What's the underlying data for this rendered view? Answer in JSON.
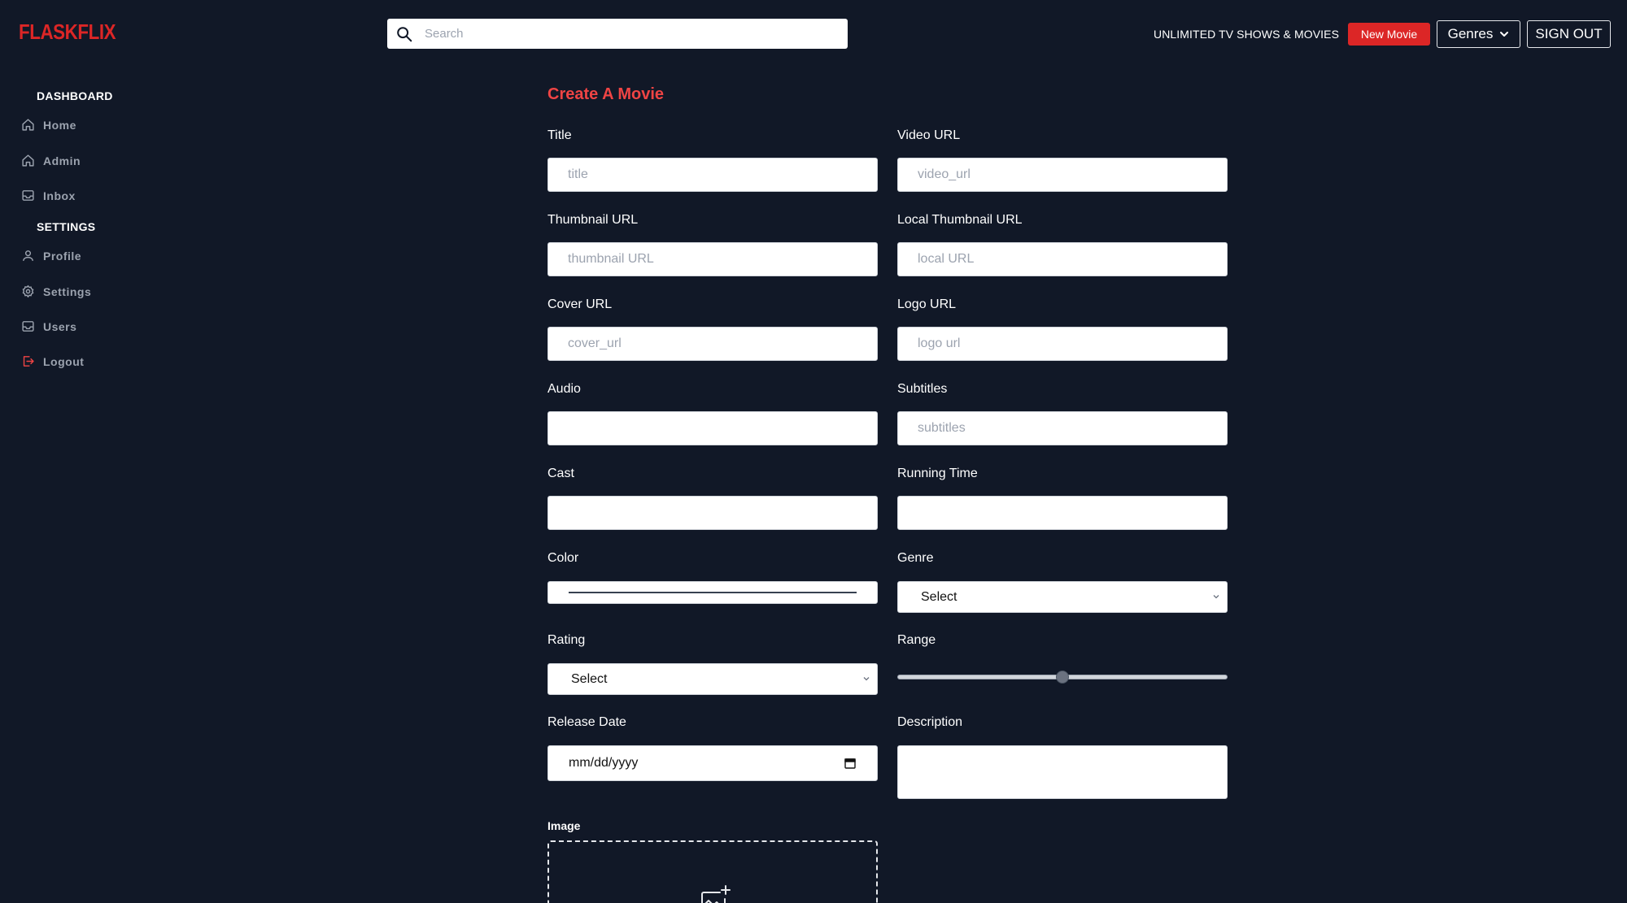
{
  "header": {
    "logo": "FLASKFLIX",
    "search_placeholder": "Search",
    "tagline": "UNLIMITED TV SHOWS & MOVIES",
    "new_movie_label": "New Movie",
    "genres_label": "Genres",
    "signout_label": "SIGN OUT"
  },
  "sidebar": {
    "sections": [
      {
        "heading": "DASHBOARD",
        "items": [
          {
            "label": "Home",
            "icon": "home-icon"
          },
          {
            "label": "Admin",
            "icon": "home-icon"
          },
          {
            "label": "Inbox",
            "icon": "inbox-icon"
          }
        ]
      },
      {
        "heading": "SETTINGS",
        "items": [
          {
            "label": "Profile",
            "icon": "user-icon"
          },
          {
            "label": "Settings",
            "icon": "gear-icon"
          },
          {
            "label": "Users",
            "icon": "inbox-icon"
          },
          {
            "label": "Logout",
            "icon": "logout-icon"
          }
        ]
      }
    ]
  },
  "form": {
    "title": "Create A Movie",
    "fields": {
      "title": {
        "label": "Title",
        "placeholder": "title"
      },
      "video_url": {
        "label": "Video URL",
        "placeholder": "video_url"
      },
      "thumbnail_url": {
        "label": "Thumbnail URL",
        "placeholder": "thumbnail URL"
      },
      "local_thumbnail_url": {
        "label": "Local Thumbnail URL",
        "placeholder": "local URL"
      },
      "cover_url": {
        "label": "Cover URL",
        "placeholder": "cover_url"
      },
      "logo_url": {
        "label": "Logo URL",
        "placeholder": "logo url"
      },
      "audio": {
        "label": "Audio",
        "placeholder": ""
      },
      "subtitles": {
        "label": "Subtitles",
        "placeholder": "subtitles"
      },
      "cast": {
        "label": "Cast",
        "placeholder": ""
      },
      "running_time": {
        "label": "Running Time",
        "placeholder": ""
      },
      "color": {
        "label": "Color",
        "value": "#000000"
      },
      "genre": {
        "label": "Genre",
        "selected": "Select"
      },
      "rating": {
        "label": "Rating",
        "selected": "Select"
      },
      "range": {
        "label": "Range",
        "value": 50,
        "min": 0,
        "max": 100
      },
      "release_date": {
        "label": "Release Date",
        "placeholder": "mm/dd/yyyy"
      },
      "description": {
        "label": "Description"
      },
      "image": {
        "label": "Image"
      }
    }
  },
  "colors": {
    "background": "#111827",
    "accent": "#dc2626",
    "title_red": "#ef4444",
    "muted": "#9ca3af"
  }
}
